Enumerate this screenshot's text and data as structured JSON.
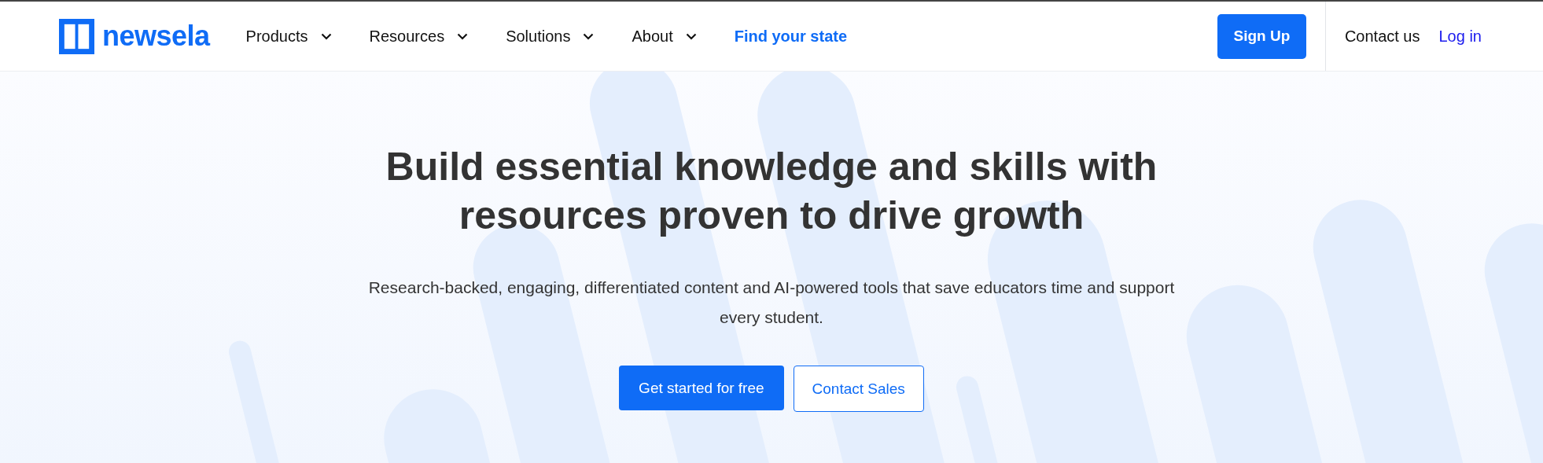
{
  "header": {
    "logo": "newsela",
    "nav": [
      {
        "label": "Products",
        "kind": "dropdown"
      },
      {
        "label": "Resources",
        "kind": "dropdown"
      },
      {
        "label": "Solutions",
        "kind": "dropdown"
      },
      {
        "label": "About",
        "kind": "dropdown"
      },
      {
        "label": "Find your state",
        "kind": "link"
      }
    ],
    "sign_up": "Sign Up",
    "contact": "Contact us",
    "login": "Log in"
  },
  "hero": {
    "title": "Build essential knowledge and skills with resources proven to drive growth",
    "subtitle": "Research-backed, engaging, differentiated content and AI-powered tools that save educators time and support every student.",
    "primary_button": "Get started for free",
    "secondary_button": "Contact Sales"
  }
}
